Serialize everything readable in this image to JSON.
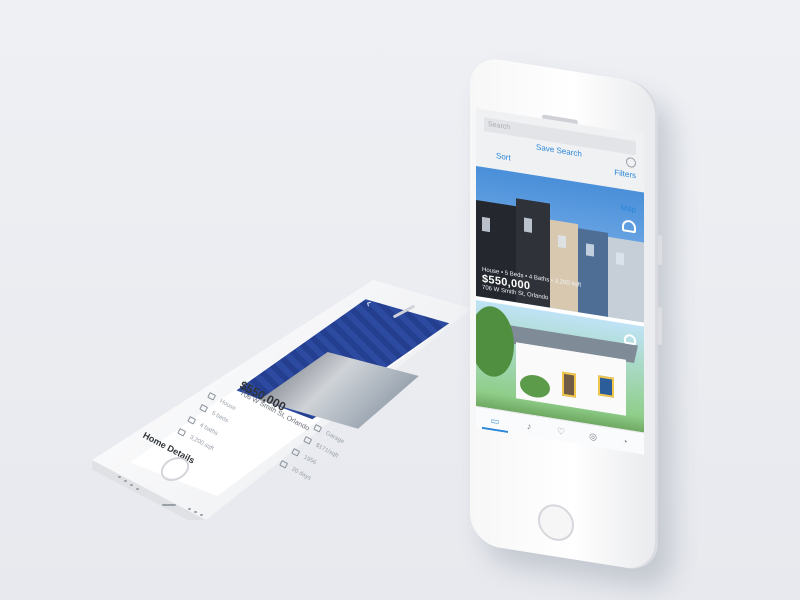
{
  "standing_phone": {
    "search_placeholder": "Search",
    "sort_label": "Sort",
    "filters_label": "Filters",
    "save_search_label": "Save Search",
    "map_label": "Map",
    "listing_1": {
      "summary": "House • 5 Beds • 4 Baths • 3,200 sqft",
      "price": "$550,000",
      "address": "706 W Smith St, Orlando"
    },
    "tabs": [
      {
        "name": "home-tab",
        "icon": "home-icon",
        "glyph": "▭"
      },
      {
        "name": "notifications-tab",
        "icon": "bell-icon",
        "glyph": "♪"
      },
      {
        "name": "favorites-tab",
        "icon": "heart-icon",
        "glyph": "♡"
      },
      {
        "name": "explore-tab",
        "icon": "compass-icon",
        "glyph": "◎"
      },
      {
        "name": "more-tab",
        "icon": "more-icon",
        "glyph": "◔"
      }
    ],
    "accent_color": "#2a86d8"
  },
  "lying_phone": {
    "back_glyph": "‹",
    "price": "$550,000",
    "address": "706 W Smith St, Orlando",
    "details_heading": "Home Details",
    "details_left": [
      {
        "icon": "house-icon",
        "label": "House"
      },
      {
        "icon": "bed-icon",
        "label": "5 beds"
      },
      {
        "icon": "bath-icon",
        "label": "4 baths"
      },
      {
        "icon": "area-icon",
        "label": "3,200 sqft"
      }
    ],
    "details_right": [
      {
        "icon": "garage-icon",
        "label": "Garage"
      },
      {
        "icon": "price-per-sqft-icon",
        "label": "$171/sqft"
      },
      {
        "icon": "calendar-icon",
        "label": "1956"
      },
      {
        "icon": "hourglass-icon",
        "label": "20 days"
      }
    ]
  }
}
